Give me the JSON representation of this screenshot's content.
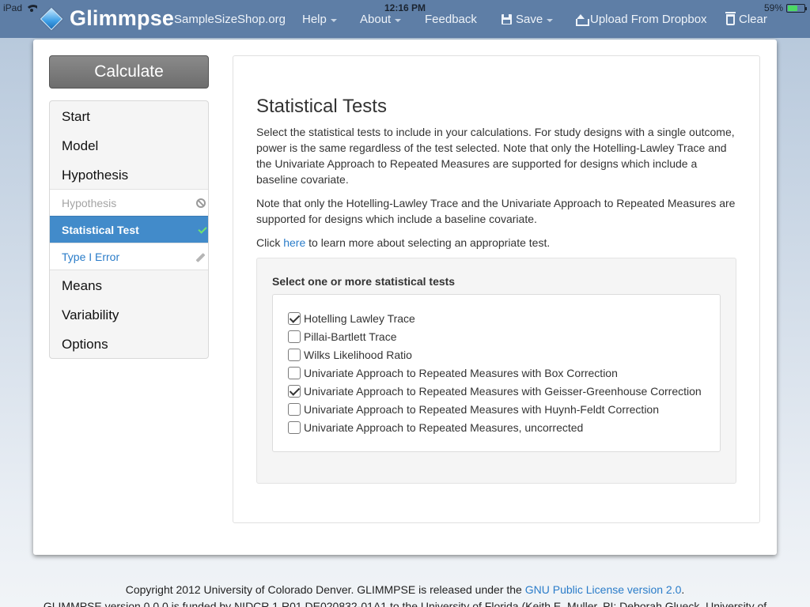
{
  "status_bar": {
    "device": "iPad",
    "time": "12:16 PM",
    "battery": "59%",
    "battery_level": 0.59
  },
  "nav": {
    "brand": "Glimmpse",
    "items": {
      "sample_size_shop": "SampleSizeShop.org",
      "help": "Help",
      "about": "About",
      "feedback": "Feedback",
      "save": "Save",
      "upload": "Upload From Dropbox",
      "clear": "Clear"
    }
  },
  "sidebar": {
    "calculate": "Calculate",
    "start": "Start",
    "model": "Model",
    "hypothesis_header": "Hypothesis",
    "hypothesis_sub": "Hypothesis",
    "statistical_test": "Statistical Test",
    "type1_error": "Type I Error",
    "means": "Means",
    "variability": "Variability",
    "options": "Options"
  },
  "main": {
    "title": "Statistical Tests",
    "para1": "Select the statistical tests to include in your calculations. For study designs with a single outcome, power is the same regardless of the test selected. Note that only the Hotelling-Lawley Trace and the Univariate Approach to Repeated Measures are supported for designs which include a baseline covariate.",
    "para2": "Note that only the Hotelling-Lawley Trace and the Univariate Approach to Repeated Measures are supported for designs which include a baseline covariate.",
    "para3_prefix": "Click ",
    "para3_link": "here",
    "para3_suffix": " to learn more about selecting an appropriate test.",
    "tests_label": "Select one or more statistical tests",
    "tests": [
      {
        "label": "Hotelling Lawley Trace",
        "checked": true
      },
      {
        "label": "Pillai-Bartlett Trace",
        "checked": false
      },
      {
        "label": "Wilks Likelihood Ratio",
        "checked": false
      },
      {
        "label": "Univariate Approach to Repeated Measures with Box Correction",
        "checked": false
      },
      {
        "label": "Univariate Approach to Repeated Measures with Geisser-Greenhouse Correction",
        "checked": true
      },
      {
        "label": "Univariate Approach to Repeated Measures with Huynh-Feldt Correction",
        "checked": false
      },
      {
        "label": "Univariate Approach to Repeated Measures, uncorrected",
        "checked": false
      }
    ]
  },
  "footer": {
    "line1_prefix": "Copyright 2012 University of Colorado Denver. GLIMMPSE is released under the ",
    "license_link": "GNU Public License version 2.0",
    "line1_suffix": ".",
    "line2": "GLIMMPSE version 0.0.0 is funded by NIDCR 1 R01 DE020832-01A1 to the University of Florida (Keith E. Muller, PI; Deborah Glueck, University of"
  }
}
